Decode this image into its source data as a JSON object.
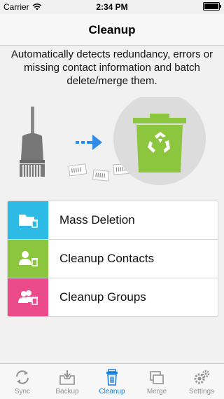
{
  "status_bar": {
    "carrier": "Carrier",
    "time": "2:34 PM"
  },
  "nav": {
    "title": "Cleanup"
  },
  "description": "Automatically detects redundancy, errors or missing contact information and batch delete/merge them.",
  "illustration": {
    "bin_color": "#8cc63f",
    "circle_color": "#dcdcdc",
    "arrow_color": "#2e8be6"
  },
  "menu": [
    {
      "label": "Mass Deletion",
      "icon": "folder-delete-icon",
      "color": "#2dbbe6"
    },
    {
      "label": "Cleanup Contacts",
      "icon": "contact-delete-icon",
      "color": "#8cc63f"
    },
    {
      "label": "Cleanup Groups",
      "icon": "group-delete-icon",
      "color": "#ec4b8b"
    }
  ],
  "tabs": [
    {
      "label": "Sync",
      "icon": "sync-icon",
      "active": false
    },
    {
      "label": "Backup",
      "icon": "backup-icon",
      "active": false
    },
    {
      "label": "Cleanup",
      "icon": "trash-icon",
      "active": true
    },
    {
      "label": "Merge",
      "icon": "merge-icon",
      "active": false
    },
    {
      "label": "Settings",
      "icon": "gear-icon",
      "active": false
    }
  ]
}
